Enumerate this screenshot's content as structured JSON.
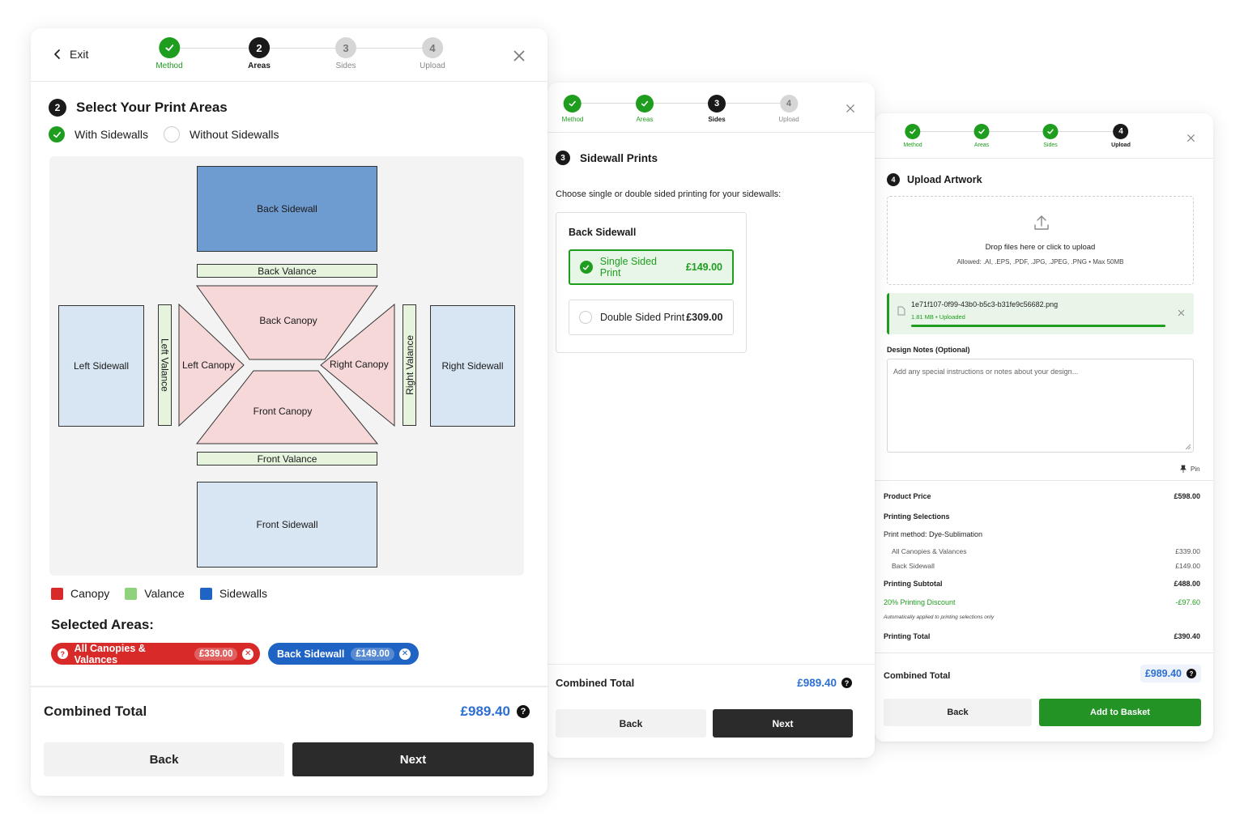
{
  "steps": {
    "method": "Method",
    "areas": "Areas",
    "sides": "Sides",
    "upload": "Upload",
    "n2": "2",
    "n3": "3",
    "n4": "4"
  },
  "colors": {
    "green": "#1f9d1f",
    "blue_price": "#2d6fd1",
    "canopy_red": "#d92a2a",
    "sidewall_blue": "#1f63c4",
    "dark": "#2b2b2b"
  },
  "panel1": {
    "exit_label": "Exit",
    "section_number": "2",
    "title": "Select Your Print Areas",
    "option_with": "With Sidewalls",
    "option_without": "Without Sidewalls",
    "areas": {
      "back_sidewall": "Back Sidewall",
      "back_valance": "Back Valance",
      "back_canopy": "Back Canopy",
      "left_sidewall": "Left Sidewall",
      "left_valance": "Left Valance",
      "left_canopy": "Left Canopy",
      "right_canopy": "Right Canopy",
      "right_valance": "Right Valance",
      "right_sidewall": "Right Sidewall",
      "front_canopy": "Front Canopy",
      "front_valance": "Front Valance",
      "front_sidewall": "Front Sidewall"
    },
    "legend": [
      "Canopy",
      "Valance",
      "Sidewalls"
    ],
    "selected_title": "Selected Areas:",
    "chips": [
      {
        "label": "All Canopies & Valances",
        "price": "£339.00"
      },
      {
        "label": "Back Sidewall",
        "price": "£149.00"
      }
    ],
    "combined_label": "Combined Total",
    "combined_value": "£989.40",
    "back": "Back",
    "next": "Next"
  },
  "panel2": {
    "section_number": "3",
    "title": "Sidewall Prints",
    "subtitle": "Choose single or double sided printing for your sidewalls:",
    "card_title": "Back Sidewall",
    "single_label": "Single Sided Print",
    "single_price": "£149.00",
    "double_label": "Double Sided Print",
    "double_price": "£309.00",
    "combined_label": "Combined Total",
    "combined_value": "£989.40",
    "back": "Back",
    "next": "Next"
  },
  "panel3": {
    "section_number": "4",
    "title": "Upload Artwork",
    "drop_text": "Drop files here or click to upload",
    "allowed_text": "Allowed: .AI, .EPS, .PDF, .JPG, .JPEG, .PNG • Max 50MB",
    "file_name": "1e71f107-0f99-43b0-b5c3-b31fe9c56682.png",
    "file_meta": "1.81 MB • Uploaded",
    "upload_progress": 1.0,
    "notes_label": "Design Notes (Optional)",
    "notes_placeholder": "Add any special instructions or notes about your design...",
    "pin_label": "Pin",
    "summary": {
      "product_price_label": "Product Price",
      "product_price": "£598.00",
      "printing_selections": "Printing Selections",
      "print_method": "Print method: Dye-Sublimation",
      "canopies_label": "All Canopies & Valances",
      "canopies_price": "£339.00",
      "back_sidewall_label": "Back Sidewall",
      "back_sidewall_price": "£149.00",
      "subtotal_label": "Printing Subtotal",
      "subtotal": "£488.00",
      "discount_label": "20% Printing Discount",
      "discount": "-£97.60",
      "discount_note": "Automatically applied to printing selections only",
      "printing_total_label": "Printing Total",
      "printing_total": "£390.40"
    },
    "combined_label": "Combined Total",
    "combined_value": "£989.40",
    "back": "Back",
    "add_to_basket": "Add to Basket"
  }
}
